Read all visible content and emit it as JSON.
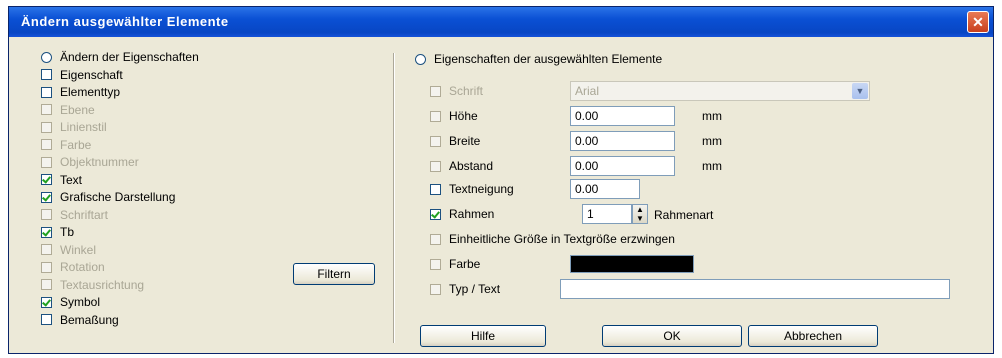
{
  "window": {
    "title": "Ändern ausgewählter Elemente",
    "close_glyph": "✕"
  },
  "left_options": [
    {
      "label": "Ändern der Eigenschaften",
      "type": "radio",
      "checked": false,
      "disabled": false
    },
    {
      "label": "Eigenschaft",
      "type": "checkbox",
      "checked": false,
      "disabled": false
    },
    {
      "label": "Elementtyp",
      "type": "checkbox",
      "checked": false,
      "disabled": false
    },
    {
      "label": "Ebene",
      "type": "checkbox",
      "checked": false,
      "disabled": true
    },
    {
      "label": "Linienstil",
      "type": "checkbox",
      "checked": false,
      "disabled": true
    },
    {
      "label": "Farbe",
      "type": "checkbox",
      "checked": false,
      "disabled": true
    },
    {
      "label": "Objektnummer",
      "type": "checkbox",
      "checked": false,
      "disabled": true
    },
    {
      "label": "Text",
      "type": "checkbox",
      "checked": true,
      "disabled": false
    },
    {
      "label": "Grafische Darstellung",
      "type": "checkbox",
      "checked": true,
      "disabled": false
    },
    {
      "label": "Schriftart",
      "type": "checkbox",
      "checked": false,
      "disabled": true
    },
    {
      "label": "Tb",
      "type": "checkbox",
      "checked": true,
      "disabled": false
    },
    {
      "label": "Winkel",
      "type": "checkbox",
      "checked": false,
      "disabled": true
    },
    {
      "label": "Rotation",
      "type": "checkbox",
      "checked": false,
      "disabled": true
    },
    {
      "label": "Textausrichtung",
      "type": "checkbox",
      "checked": false,
      "disabled": true
    },
    {
      "label": "Symbol",
      "type": "checkbox",
      "checked": true,
      "disabled": false
    },
    {
      "label": "Bemaßung",
      "type": "checkbox",
      "checked": false,
      "disabled": false
    }
  ],
  "buttons": {
    "apply": "Filtern",
    "help": "Hilfe",
    "ok": "OK",
    "cancel": "Abbrechen"
  },
  "right": {
    "header_label": "Eigenschaften der ausgewählten Elemente",
    "font_label": "Schrift",
    "font_value": "Arial",
    "rows": [
      {
        "label": "Höhe",
        "value": "0.00",
        "unit": "mm",
        "checked": false
      },
      {
        "label": "Breite",
        "value": "0.00",
        "unit": "mm",
        "checked": false
      },
      {
        "label": "Abstand",
        "value": "0.00",
        "unit": "mm",
        "checked": false
      }
    ],
    "slant_label": "Textneigung",
    "slant_value": "0.00",
    "frame_label": "Rahmen",
    "frame_value": "1",
    "frame_suffix": "Rahmenart",
    "frame_checked": true,
    "uniform_label": "Einheitliche Größe in Textgröße erzwingen",
    "color_label": "Farbe",
    "color_hex": "#000000",
    "text_label": "Typ / Text",
    "text_value": ""
  }
}
